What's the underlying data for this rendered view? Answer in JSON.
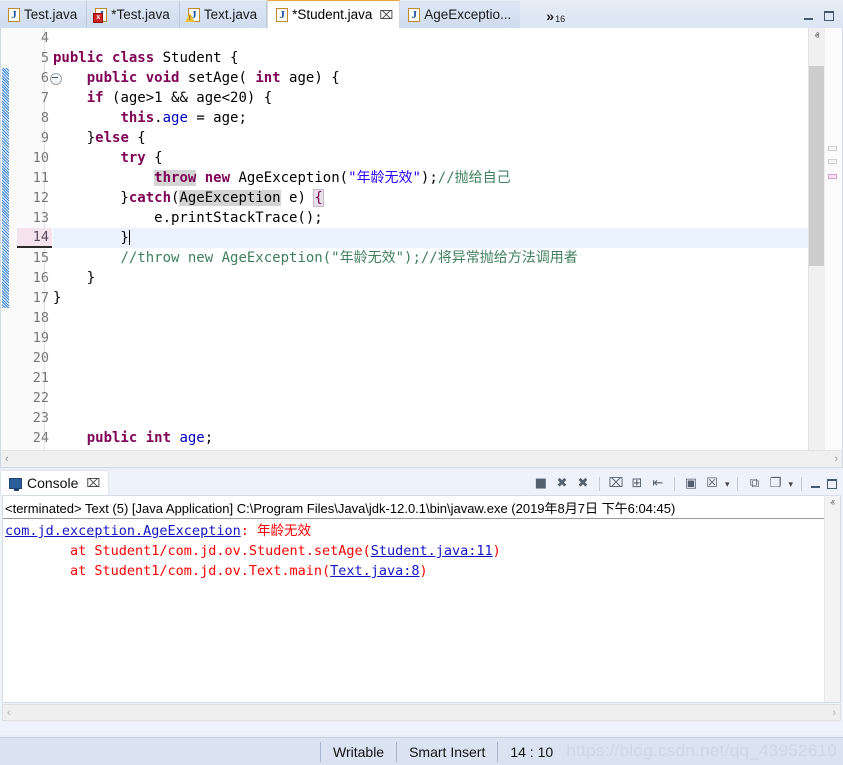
{
  "editor": {
    "tabs": [
      {
        "label": "Test.java",
        "icon": "java-file-icon",
        "marker": "none",
        "active": false,
        "dirty": false
      },
      {
        "label": "*Test.java",
        "icon": "java-file-icon",
        "marker": "error",
        "active": false,
        "dirty": true
      },
      {
        "label": "Text.java",
        "icon": "java-file-icon",
        "marker": "warning",
        "active": false,
        "dirty": false
      },
      {
        "label": "*Student.java",
        "icon": "java-file-icon",
        "marker": "none",
        "active": true,
        "dirty": true
      },
      {
        "label": "AgeExceptio...",
        "icon": "java-file-icon",
        "marker": "none",
        "active": false,
        "dirty": false
      }
    ],
    "close_glyph": "⌧",
    "overflow": {
      "glyph": "»",
      "count": "16"
    },
    "window_buttons": {
      "minimize": "minimize-icon",
      "maximize": "maximize-icon"
    },
    "line_numbers": [
      "4",
      "5",
      "6",
      "7",
      "8",
      "9",
      "10",
      "11",
      "12",
      "13",
      "14",
      "15",
      "16",
      "17",
      "18",
      "19",
      "20",
      "21",
      "22",
      "23",
      "24"
    ],
    "current_line": "14",
    "fold_line": "6",
    "change_bar_from": "6",
    "change_bar_to": "17",
    "code": [
      {
        "n": "4",
        "tokens": []
      },
      {
        "n": "5",
        "tokens": [
          {
            "t": "public ",
            "c": "kw"
          },
          {
            "t": "class ",
            "c": "kw"
          },
          {
            "t": "Student {",
            "c": ""
          }
        ]
      },
      {
        "n": "6",
        "tokens": [
          {
            "t": "    ",
            "c": ""
          },
          {
            "t": "public ",
            "c": "kw"
          },
          {
            "t": "void ",
            "c": "kw"
          },
          {
            "t": "setAge( ",
            "c": ""
          },
          {
            "t": "int ",
            "c": "kw"
          },
          {
            "t": "age) {",
            "c": ""
          }
        ]
      },
      {
        "n": "7",
        "tokens": [
          {
            "t": "    ",
            "c": ""
          },
          {
            "t": "if ",
            "c": "kw"
          },
          {
            "t": "(age>1 && age<20) {",
            "c": ""
          }
        ]
      },
      {
        "n": "8",
        "tokens": [
          {
            "t": "        ",
            "c": ""
          },
          {
            "t": "this",
            "c": "kw"
          },
          {
            "t": ".",
            "c": ""
          },
          {
            "t": "age",
            "c": "fld"
          },
          {
            "t": " = age;",
            "c": ""
          }
        ]
      },
      {
        "n": "9",
        "tokens": [
          {
            "t": "    }",
            "c": ""
          },
          {
            "t": "else",
            "c": "kw"
          },
          {
            "t": " {",
            "c": ""
          }
        ]
      },
      {
        "n": "10",
        "tokens": [
          {
            "t": "        ",
            "c": ""
          },
          {
            "t": "try",
            "c": "kw"
          },
          {
            "t": " {",
            "c": ""
          }
        ]
      },
      {
        "n": "11",
        "tokens": [
          {
            "t": "            ",
            "c": ""
          },
          {
            "t": "throw",
            "c": "kw hl"
          },
          {
            "t": " ",
            "c": ""
          },
          {
            "t": "new",
            "c": "kw"
          },
          {
            "t": " AgeException(",
            "c": ""
          },
          {
            "t": "\"年龄无效\"",
            "c": "str"
          },
          {
            "t": ");",
            "c": ""
          },
          {
            "t": "//抛给自己",
            "c": "cmt"
          }
        ]
      },
      {
        "n": "12",
        "tokens": [
          {
            "t": "        }",
            "c": ""
          },
          {
            "t": "catch",
            "c": "kw"
          },
          {
            "t": "(",
            "c": ""
          },
          {
            "t": "AgeException",
            "c": "hl"
          },
          {
            "t": " e) ",
            "c": ""
          },
          {
            "t": "{",
            "c": "brk"
          }
        ]
      },
      {
        "n": "13",
        "tokens": [
          {
            "t": "            e.printStackTrace();",
            "c": ""
          }
        ]
      },
      {
        "n": "14",
        "tokens": [
          {
            "t": "        }",
            "c": ""
          }
        ]
      },
      {
        "n": "15",
        "tokens": [
          {
            "t": "        ",
            "c": ""
          },
          {
            "t": "//throw new AgeException(\"年龄无效\");//将异常抛给方法调用者",
            "c": "cmt"
          }
        ]
      },
      {
        "n": "16",
        "tokens": [
          {
            "t": "    }",
            "c": ""
          }
        ]
      },
      {
        "n": "17",
        "tokens": [
          {
            "t": "}",
            "c": ""
          }
        ]
      },
      {
        "n": "18",
        "tokens": []
      },
      {
        "n": "19",
        "tokens": []
      },
      {
        "n": "20",
        "tokens": []
      },
      {
        "n": "21",
        "tokens": []
      },
      {
        "n": "22",
        "tokens": []
      },
      {
        "n": "23",
        "tokens": []
      },
      {
        "n": "24",
        "tokens": [
          {
            "t": "    ",
            "c": ""
          },
          {
            "t": "public ",
            "c": "kw"
          },
          {
            "t": "int ",
            "c": "kw"
          },
          {
            "t": "age",
            "c": "fld"
          },
          {
            "t": ";",
            "c": ""
          }
        ]
      }
    ],
    "scroll_up_glyph": "ⱏ",
    "scroll_down_glyph": "ⱟ",
    "hscroll_left_glyph": "‹",
    "hscroll_right_glyph": "›"
  },
  "console": {
    "tab_label": "Console",
    "tab_icon": "console-monitor-icon",
    "close_glyph": "⌧",
    "toolbar": [
      {
        "name": "stop-button",
        "glyph": "■"
      },
      {
        "name": "terminate-remove-button",
        "glyph": "✖"
      },
      {
        "name": "remove-all-terminated-button",
        "glyph": "✖"
      },
      {
        "name": "clear-console-button",
        "glyph": "⌧"
      },
      {
        "name": "scroll-lock-button",
        "glyph": "⊞"
      },
      {
        "name": "show-console-when-output-button",
        "glyph": "⇤"
      },
      {
        "name": "pin-console-button",
        "glyph": "▣"
      },
      {
        "name": "display-selected-console-button",
        "glyph": "☒"
      },
      {
        "name": "open-console-button",
        "glyph": "⧉"
      },
      {
        "name": "new-console-view-button",
        "glyph": "❐"
      }
    ],
    "terminated_line": "<terminated> Text (5) [Java Application] C:\\Program Files\\Java\\jdk-12.0.1\\bin\\javaw.exe (2019年8月7日 下午6:04:45)",
    "output": [
      {
        "parts": [
          {
            "t": "com.jd.exception.AgeException",
            "c": "lnk"
          },
          {
            "t": ": ",
            "c": ""
          },
          {
            "t": "年龄无效",
            "c": ""
          }
        ]
      },
      {
        "parts": [
          {
            "t": "        at Student1/com.jd.ov.Student.setAge(",
            "c": ""
          },
          {
            "t": "Student.java:11",
            "c": "lnk"
          },
          {
            "t": ")",
            "c": ""
          }
        ]
      },
      {
        "parts": [
          {
            "t": "        at Student1/com.jd.ov.Text.main(",
            "c": ""
          },
          {
            "t": "Text.java:8",
            "c": "lnk"
          },
          {
            "t": ")",
            "c": ""
          }
        ]
      }
    ],
    "minimize_icon": "minimize-icon",
    "maximize_icon": "maximize-icon"
  },
  "status_bar": {
    "writable": "Writable",
    "insert_mode": "Smart Insert",
    "cursor_position": "14 : 10",
    "watermark": "https://blog.csdn.net/qq_43952610"
  },
  "colors": {
    "keyword": "#7f0055",
    "field": "#0000c0",
    "string": "#2a00ff",
    "comment": "#3f7f5f",
    "error_text": "#ff0000",
    "link": "#1414c8",
    "current_line_bg": "#eaf2fd",
    "active_tab_border": "#e8a33d"
  }
}
